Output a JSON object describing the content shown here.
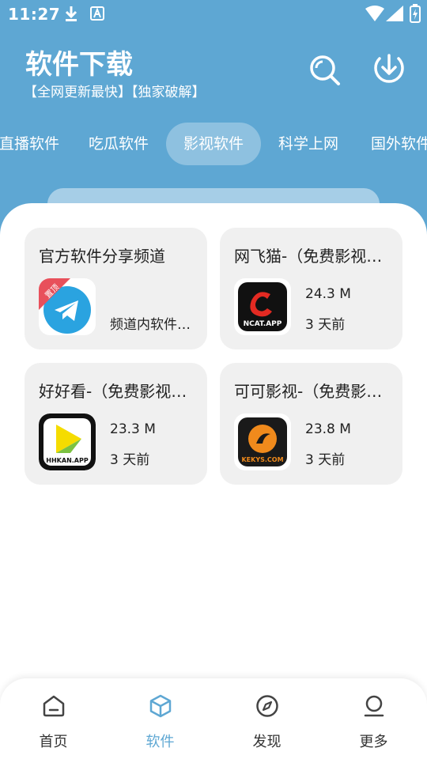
{
  "status_bar": {
    "time": "11:27"
  },
  "header": {
    "title": "软件下载",
    "subtitle": "【全网更新最快】【独家破解】",
    "search_icon": "search-icon",
    "download_icon": "download-icon"
  },
  "tabs": [
    {
      "label": "直播软件",
      "active": false
    },
    {
      "label": "吃瓜软件",
      "active": false
    },
    {
      "label": "影视软件",
      "active": true
    },
    {
      "label": "科学上网",
      "active": false
    },
    {
      "label": "国外软件",
      "active": false
    }
  ],
  "cards": [
    {
      "title": "官方软件分享频道",
      "icon": "telegram-icon",
      "badge": "置顶",
      "description": "频道内软件均已破解"
    },
    {
      "title": "网飞猫-（免费影视大全）",
      "icon": "ncat-app-icon",
      "icon_text": "NCAT.APP",
      "size": "24.3 M",
      "time": "3 天前"
    },
    {
      "title": "好好看-（免费影视大全）",
      "icon": "hhkan-app-icon",
      "icon_text": "HHKAN.APP",
      "size": "23.3 M",
      "time": "3 天前"
    },
    {
      "title": "可可影视-（免费影视大全）",
      "icon": "kekys-app-icon",
      "icon_text": "KEKYS.COM",
      "size": "23.8 M",
      "time": "3 天前"
    }
  ],
  "bottom_nav": [
    {
      "label": "首页",
      "icon": "home-icon",
      "active": false
    },
    {
      "label": "软件",
      "icon": "package-icon",
      "active": true
    },
    {
      "label": "发现",
      "icon": "compass-icon",
      "active": false
    },
    {
      "label": "更多",
      "icon": "user-icon",
      "active": false
    }
  ],
  "colors": {
    "primary": "#5ea7d3",
    "card_bg": "#f0f0f0",
    "badge": "#e8505b",
    "telegram": "#2aa3e0",
    "ncat_red": "#e32a22",
    "hhkan_yellow": "#f5dc00",
    "kekys_orange": "#f08a1c"
  }
}
